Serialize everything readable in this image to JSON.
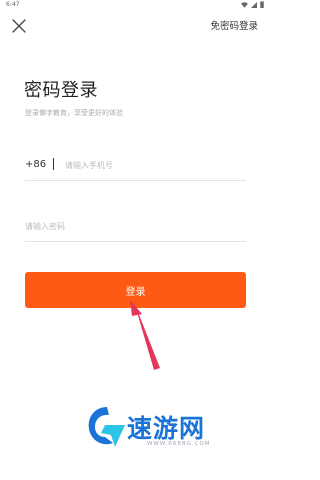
{
  "status_bar": {
    "time": "6:47"
  },
  "header": {
    "close_icon": "close-icon",
    "switch_login_label": "免密码登录"
  },
  "title": "密码登录",
  "subtitle": "登录懒字教育，享受更好的体验",
  "phone": {
    "country_code": "+86",
    "placeholder": "请输入手机号",
    "value": ""
  },
  "password": {
    "placeholder": "请输入密码",
    "value": ""
  },
  "login_button": {
    "label": "登录",
    "color": "#ff5a14"
  },
  "watermark": {
    "text": "速游网",
    "url": "WWW.668BG.COM"
  }
}
